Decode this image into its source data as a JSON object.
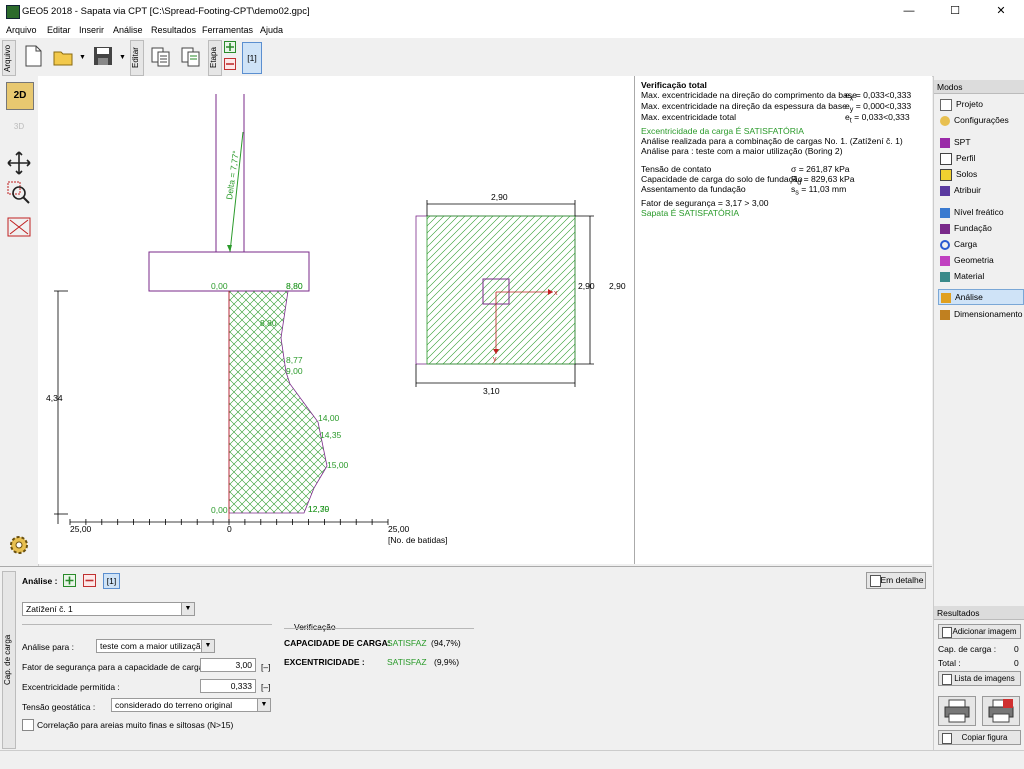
{
  "window": {
    "title": "GEO5 2018 - Sapata via CPT [C:\\Spread-Footing-CPT\\demo02.gpc]",
    "minimize": "—",
    "maximize": "☐",
    "close": "✕"
  },
  "menu": [
    "Arquivo",
    "Editar",
    "Inserir",
    "Análise",
    "Resultados",
    "Ferramentas",
    "Ajuda"
  ],
  "toolbar": {
    "tab_arquivo": "Arquivo",
    "tab_editar": "Editar",
    "tab_etapa": "Etapa",
    "stage": "[1]"
  },
  "lefttools": {
    "view2d": "2D",
    "view3d": "3D"
  },
  "drawing": {
    "delta": "Delta = 7,77°",
    "left_labels": [
      {
        "t": "0,00"
      },
      {
        "t": "0,00"
      }
    ],
    "profile_labels": [
      "8,80",
      "8,80",
      "8,80",
      "8,77",
      "9,00",
      "14,00",
      "14,35",
      "15,00",
      "12,70",
      "12,39"
    ],
    "depth": "4,34",
    "axis_ticks": [
      "25,00",
      "0",
      "25,00"
    ],
    "axis_unit": "[No. de batidas]",
    "plan_dim_top": "2,90",
    "plan_dim_right_inner": "2,90",
    "plan_dim_right_outer": "2,90",
    "plan_dim_bottom": "3,10",
    "x_label": "x",
    "y_label": "y"
  },
  "results": {
    "heading": "Verificação total",
    "ecc": [
      {
        "label": "Max. excentricidade na direção do comprimento da base",
        "sym": "e",
        "sub": "x",
        "val": " = 0,033<0,333"
      },
      {
        "label": "Max. excentricidade na direção da espessura da base",
        "sym": "e",
        "sub": "y",
        "val": " = 0,000<0,333"
      },
      {
        "label": "Max. excentricidade total",
        "sym": "e",
        "sub": "t",
        "val": " = 0,033<0,333"
      }
    ],
    "ecc_ok": "Excentricidade da carga É SATISFATÓRIA",
    "combo": "Análise realizada para a combinação de cargas No. 1. (Zatížení č. 1)",
    "for": "Análise para : teste com a maior utilização (Boring 2)",
    "vals": [
      {
        "label": "Tensão de contato",
        "sym": "σ",
        "sub": "",
        "val": " = 261,87 kPa"
      },
      {
        "label": "Capacidade de carga do solo de fundação",
        "sym": "R",
        "sub": "d",
        "val": " = 829,63 kPa"
      },
      {
        "label": "Assentamento da fundação",
        "sym": "s",
        "sub": "s",
        "val": " = 11,03 mm"
      }
    ],
    "fs": "Fator de segurança = 3,17 > 3,00",
    "ok": "Sapata É SATISFATÓRIA"
  },
  "modes": {
    "header": "Modos",
    "items": [
      "Projeto",
      "Configurações",
      "SPT",
      "Perfil",
      "Solos",
      "Atribuir",
      "Nível freático",
      "Fundação",
      "Carga",
      "Geometria",
      "Material",
      "Análise",
      "Dimensionamento"
    ],
    "selected": "Análise"
  },
  "bottom": {
    "side_tab": "Cap. de carga",
    "analise_label": "Análise :",
    "stage": "[1]",
    "detail_btn": "Em detalhe",
    "combo_value": "Zatížení č. 1",
    "analise_para_label": "Análise para :",
    "analise_para_value": "teste com a maior utilização",
    "fs_label": "Fator de segurança para a capacidade de carga :",
    "fs_value": "3,00",
    "fs_unit": "[–]",
    "ecc_label": "Excentricidade permitida :",
    "ecc_value": "0,333",
    "ecc_unit": "[–]",
    "geo_label": "Tensão geostática :",
    "geo_value": "considerado do terreno original",
    "corr_label": "Correlação para areias muito finas e siltosas (N>15)",
    "verif_title": "Verificação",
    "v1_label": "CAPACIDADE DE CARGA:",
    "v1_status": "SATISFAZ",
    "v1_pct": "(94,7%)",
    "v2_label": "EXCENTRICIDADE :",
    "v2_status": "SATISFAZ",
    "v2_pct": "(9,9%)"
  },
  "res_panel": {
    "header": "Resultados",
    "add_img": "Adicionar imagem",
    "cap_label": "Cap. de carga :",
    "cap_val": "0",
    "total_label": "Total :",
    "total_val": "0",
    "list_img": "Lista de imagens",
    "copy": "Copiar figura"
  }
}
